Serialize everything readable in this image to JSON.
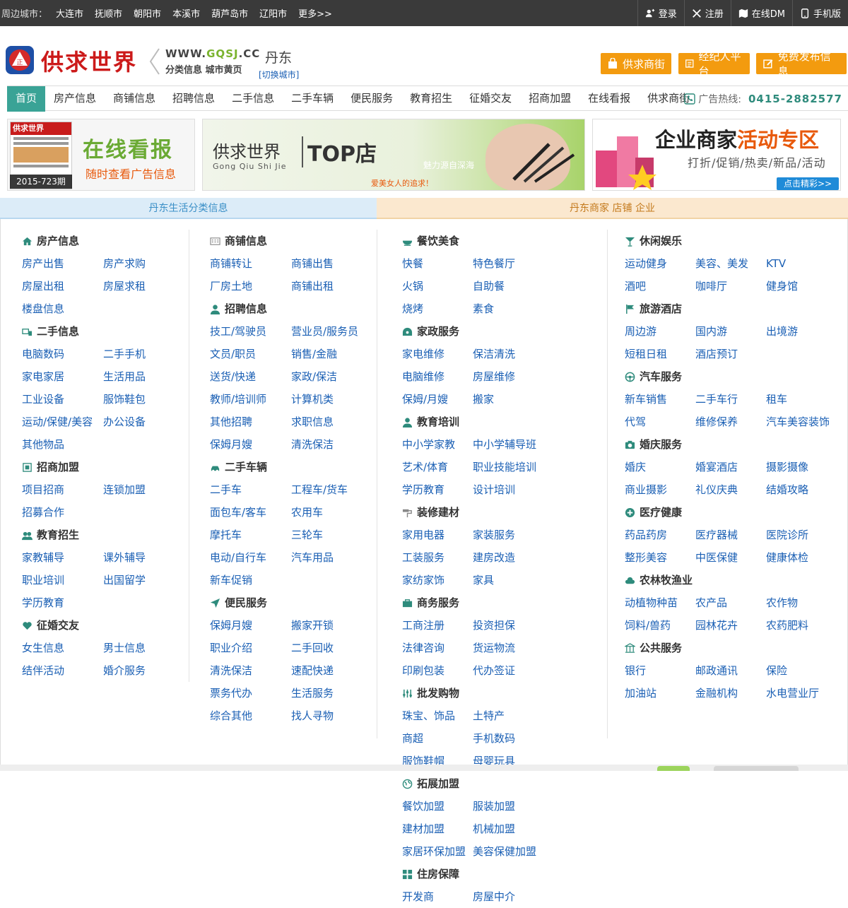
{
  "topbar": {
    "nearby_label": "周边城市：",
    "cities": [
      "大连市",
      "抚顺市",
      "朝阳市",
      "本溪市",
      "葫芦岛市",
      "辽阳市",
      "更多>>"
    ],
    "login": "登录",
    "register": "注册",
    "online_dm": "在线DM",
    "mobile": "手机版"
  },
  "header": {
    "logo_text": "供求世界",
    "logo_badge": "正",
    "url_prefix": "WWW.",
    "url_brand": "GQSJ",
    "url_suffix": ".CC",
    "subtitle": "分类信息  城市黄页",
    "city": "丹东",
    "switch_city": "[切换城市]",
    "btn_street": "供求商街",
    "btn_agent": "经纪人平台",
    "btn_publish": "免费发布信息"
  },
  "nav": {
    "items": [
      "首页",
      "房产信息",
      "商铺信息",
      "招聘信息",
      "二手信息",
      "二手车辆",
      "便民服务",
      "教育招生",
      "征婚交友",
      "招商加盟",
      "在线看报",
      "供求商街"
    ],
    "hotline_label": "广告热线:",
    "hotline_number": "0415-2882577"
  },
  "banners": {
    "paper_title": "供求世界",
    "paper_issue": "2015-723期",
    "paper_t1": "在线看报",
    "paper_t2": "随时查看广告信息",
    "top_brand": "供求世界",
    "top_brand_py": "Gong Qiu Shi Jie",
    "top_label": "TOP店",
    "top_slogan1": "魅力源自深海",
    "top_slogan2": "爱美女人的追求！",
    "biz_t1a": "企业商家",
    "biz_t1b": "活动专区",
    "biz_t2": "打折/促销/热卖/新品/活动",
    "biz_more": "点击精彩>>"
  },
  "sections": {
    "left": "丹东生活分类信息",
    "right": "丹东商家  店铺  企业"
  },
  "col1": [
    {
      "title": "房产信息",
      "icon": "home-icon",
      "links": [
        "房产出售",
        "房产求购",
        "房屋出租",
        "房屋求租",
        "楼盘信息"
      ]
    },
    {
      "title": "二手信息",
      "icon": "secondhand-icon",
      "links": [
        "电脑数码",
        "二手手机",
        "家电家居",
        "生活用品",
        "工业设备",
        "服饰鞋包",
        "运动/保健/美容",
        "办公设备",
        "其他物品"
      ]
    },
    {
      "title": "招商加盟",
      "icon": "franchise-icon",
      "links": [
        "项目招商",
        "连锁加盟",
        "招募合作"
      ]
    },
    {
      "title": "教育招生",
      "icon": "education-icon",
      "links": [
        "家教辅导",
        "课外辅导",
        "职业培训",
        "出国留学",
        "学历教育"
      ]
    },
    {
      "title": "征婚交友",
      "icon": "heart-icon",
      "links": [
        "女生信息",
        "男士信息",
        "结伴活动",
        "婚介服务"
      ]
    }
  ],
  "col2": [
    {
      "title": "商铺信息",
      "icon": "shop-icon",
      "links": [
        "商铺转让",
        "商铺出售",
        "厂房土地",
        "商铺出租"
      ]
    },
    {
      "title": "招聘信息",
      "icon": "person-icon",
      "links": [
        "技工/驾驶员",
        "营业员/服务员",
        "文员/职员",
        "销售/金融",
        "送货/快递",
        "家政/保洁",
        "教师/培训师",
        "计算机类",
        "其他招聘",
        "求职信息",
        "保姆月嫂",
        "清洗保洁"
      ]
    },
    {
      "title": "二手车辆",
      "icon": "car-icon",
      "links": [
        "二手车",
        "工程车/货车",
        "面包车/客车",
        "农用车",
        "摩托车",
        "三轮车",
        "电动/自行车",
        "汽车用品",
        "新车促销"
      ]
    },
    {
      "title": "便民服务",
      "icon": "send-icon",
      "links": [
        "保姆月嫂",
        "搬家开锁",
        "职业介绍",
        "二手回收",
        "清洗保洁",
        "速配快递",
        "票务代办",
        "生活服务",
        "综合其他",
        "找人寻物"
      ]
    }
  ],
  "col3": [
    {
      "title": "餐饮美食",
      "icon": "food-icon",
      "links": [
        "快餐",
        "特色餐厅",
        "火锅",
        "自助餐",
        "烧烤",
        "素食"
      ]
    },
    {
      "title": "家政服务",
      "icon": "housekeeping-icon",
      "links": [
        "家电维修",
        "保洁清洗",
        "电脑维修",
        "房屋维修",
        "保姆/月嫂",
        "搬家"
      ]
    },
    {
      "title": "教育培训",
      "icon": "training-icon",
      "links": [
        "中小学家教",
        "中小学辅导班",
        "艺术/体育",
        "职业技能培训",
        "学历教育",
        "设计培训"
      ]
    },
    {
      "title": "装修建材",
      "icon": "renovation-icon",
      "links": [
        "家用电器",
        "家装服务",
        "工装服务",
        "建房改造",
        "家纺家饰",
        "家具"
      ]
    },
    {
      "title": "商务服务",
      "icon": "briefcase-icon",
      "links": [
        "工商注册",
        "投资担保",
        "法律咨询",
        "货运物流",
        "印刷包装",
        "代办签证"
      ]
    },
    {
      "title": "批发购物",
      "icon": "wholesale-icon",
      "links": [
        "珠宝、饰品",
        "土特产",
        "商超",
        "手机数码",
        "服饰鞋帽",
        "母婴玩具"
      ]
    },
    {
      "title": "拓展加盟",
      "icon": "globe-icon",
      "links": [
        "餐饮加盟",
        "服装加盟",
        "建材加盟",
        "机械加盟",
        "家居环保加盟",
        "美容保健加盟"
      ]
    },
    {
      "title": "住房保障",
      "icon": "housing-icon",
      "links": [
        "开发商",
        "房屋中介"
      ]
    }
  ],
  "col4": [
    {
      "title": "休闲娱乐",
      "icon": "cocktail-icon",
      "links": [
        "运动健身",
        "美容、美发",
        "KTV",
        "酒吧",
        "咖啡厅",
        "健身馆"
      ]
    },
    {
      "title": "旅游酒店",
      "icon": "flag-icon",
      "links": [
        "周边游",
        "国内游",
        "出境游",
        "短租日租",
        "酒店预订"
      ]
    },
    {
      "title": "汽车服务",
      "icon": "wheel-icon",
      "links": [
        "新车销售",
        "二手车行",
        "租车",
        "代驾",
        "维修保养",
        "汽车美容装饰"
      ]
    },
    {
      "title": "婚庆服务",
      "icon": "camera-icon",
      "links": [
        "婚庆",
        "婚宴酒店",
        "摄影摄像",
        "商业摄影",
        "礼仪庆典",
        "结婚攻略"
      ]
    },
    {
      "title": "医疗健康",
      "icon": "medical-icon",
      "links": [
        "药品药房",
        "医疗器械",
        "医院诊所",
        "整形美容",
        "中医保健",
        "健康体检"
      ]
    },
    {
      "title": "农林牧渔业",
      "icon": "cloud-icon",
      "links": [
        "动植物种苗",
        "农产品",
        "农作物",
        "饲料/兽药",
        "园林花卉",
        "农药肥料"
      ]
    },
    {
      "title": "公共服务",
      "icon": "public-icon",
      "links": [
        "银行",
        "邮政通讯",
        "保险",
        "加油站",
        "金融机构",
        "水电营业厅"
      ]
    }
  ]
}
